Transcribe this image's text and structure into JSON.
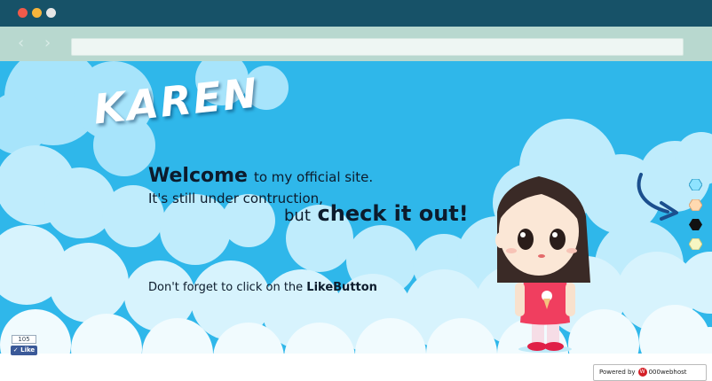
{
  "browser": {
    "dot_colors": [
      "#f05a4a",
      "#f7b53b",
      "#e6e6e6"
    ],
    "url": ""
  },
  "logo": "KAREN",
  "intro": {
    "welcome": "Welcome",
    "to_my_site": "to my official site.",
    "still_under": "It's still under contruction,",
    "but": "but",
    "check_it_out": "check it out!"
  },
  "reminder": {
    "prefix": "Don't forget to click on the",
    "like_button_text": "LikeButton"
  },
  "like_widget": {
    "count": "105",
    "label": "Like"
  },
  "powered_by": {
    "label": "Powered by",
    "brand": "000webhost"
  },
  "social_colors": [
    "#8ee3ff",
    "#ffd9b0",
    "#111111",
    "#f7f6c2"
  ]
}
